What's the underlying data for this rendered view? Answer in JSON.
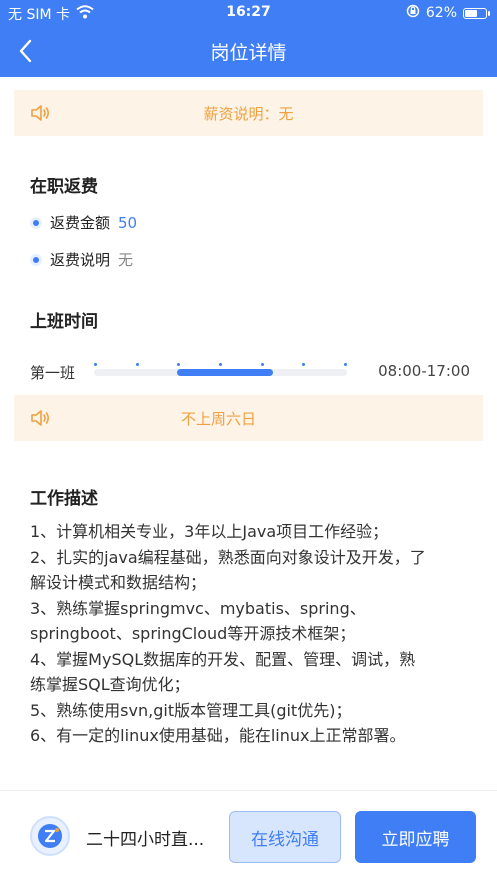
{
  "status_bar": {
    "carrier": "无 SIM 卡",
    "time": "16:27",
    "battery": "62%",
    "battery_level": 0.62,
    "icons": [
      "wifi-icon",
      "rotation-lock-icon",
      "battery-icon"
    ]
  },
  "nav": {
    "title": "岗位详情",
    "back_icon": "chevron-left-icon"
  },
  "salary_notice": {
    "icon": "speaker-icon",
    "text": "薪资说明：无"
  },
  "rebate": {
    "title": "在职返费",
    "items": [
      {
        "label": "返费金额",
        "value": "50"
      },
      {
        "label": "返费说明",
        "value": "无"
      }
    ]
  },
  "work_time": {
    "title": "上班时间",
    "shifts": [
      {
        "name": "第一班",
        "time": "08:00-17:00",
        "start_fraction": 0.33,
        "end_fraction": 0.71
      }
    ]
  },
  "weekend_notice": {
    "icon": "speaker-icon",
    "text": "不上周六日"
  },
  "job_description": {
    "title": "工作描述",
    "lines": [
      "1、计算机相关专业，3年以上Java项目工作经验；",
      "2、扎实的java编程基础，熟悉面向对象设计及开发，了解设计模式和数据结构；",
      "3、熟练掌握springmvc、mybatis、spring、springboot、springCloud等开源技术框架；",
      "4、掌握MySQL数据库的开发、配置、管理、调试，熟练掌握SQL查询优化；",
      "5、熟练使用svn,git版本管理工具(git优先)；",
      "6、有一定的linux使用基础，能在linux上正常部署。"
    ]
  },
  "bottom_bar": {
    "company_name": "二十四小时直...",
    "chat_button": "在线沟通",
    "apply_button": "立即应聘"
  },
  "colors": {
    "brand": "#3f7ef4",
    "notice_bg": "#fdf3e6",
    "notice_text": "#f0a040"
  }
}
